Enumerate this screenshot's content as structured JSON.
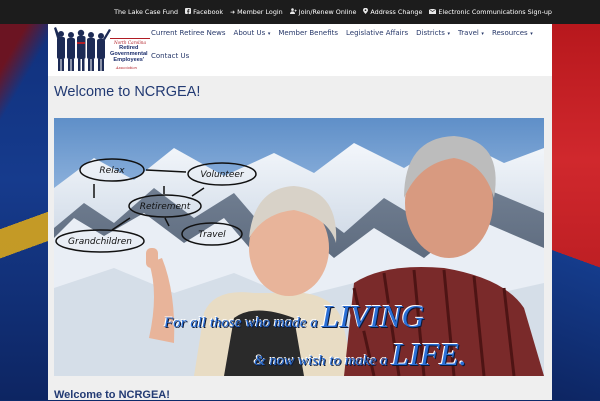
{
  "top_links": [
    {
      "label": "The Lake Case Fund",
      "icon": ""
    },
    {
      "label": "Facebook",
      "icon": "facebook-icon"
    },
    {
      "label": "Member Login",
      "icon": "login-icon"
    },
    {
      "label": "Join/Renew Online",
      "icon": "user-add-icon"
    },
    {
      "label": "Address Change",
      "icon": "map-marker-icon"
    },
    {
      "label": "Electronic Communications Sign-up",
      "icon": "envelope-icon"
    }
  ],
  "logo": {
    "north": "North Carolina",
    "name_line1": "Retired",
    "name_line2": "Governmental",
    "name_line3": "Employees'",
    "assoc": "Association"
  },
  "nav": {
    "items": [
      {
        "label": "Current Retiree News",
        "dropdown": false
      },
      {
        "label": "About Us",
        "dropdown": true
      },
      {
        "label": "Member Benefits",
        "dropdown": false
      },
      {
        "label": "Legislative Affairs",
        "dropdown": false
      },
      {
        "label": "Districts",
        "dropdown": true
      },
      {
        "label": "Travel",
        "dropdown": true
      },
      {
        "label": "Resources",
        "dropdown": true
      }
    ],
    "second_row": {
      "label": "Contact Us"
    }
  },
  "page_title": "Welcome to NCRGEA!",
  "hero": {
    "bubbles": [
      "Relax",
      "Volunteer",
      "Retirement",
      "Grandchildren",
      "Travel"
    ],
    "tagline1_pre": "For all those who made a ",
    "tagline1_big": "LIVING",
    "tagline2_pre": "& now wish to make a ",
    "tagline2_big": "LIFE."
  },
  "subtitle": "Welcome to NCRGEA!",
  "colors": {
    "accent_blue": "#223a73",
    "flag_red": "#d0282d",
    "flag_blue": "#163b8d",
    "topbar": "#1c1c1c"
  }
}
